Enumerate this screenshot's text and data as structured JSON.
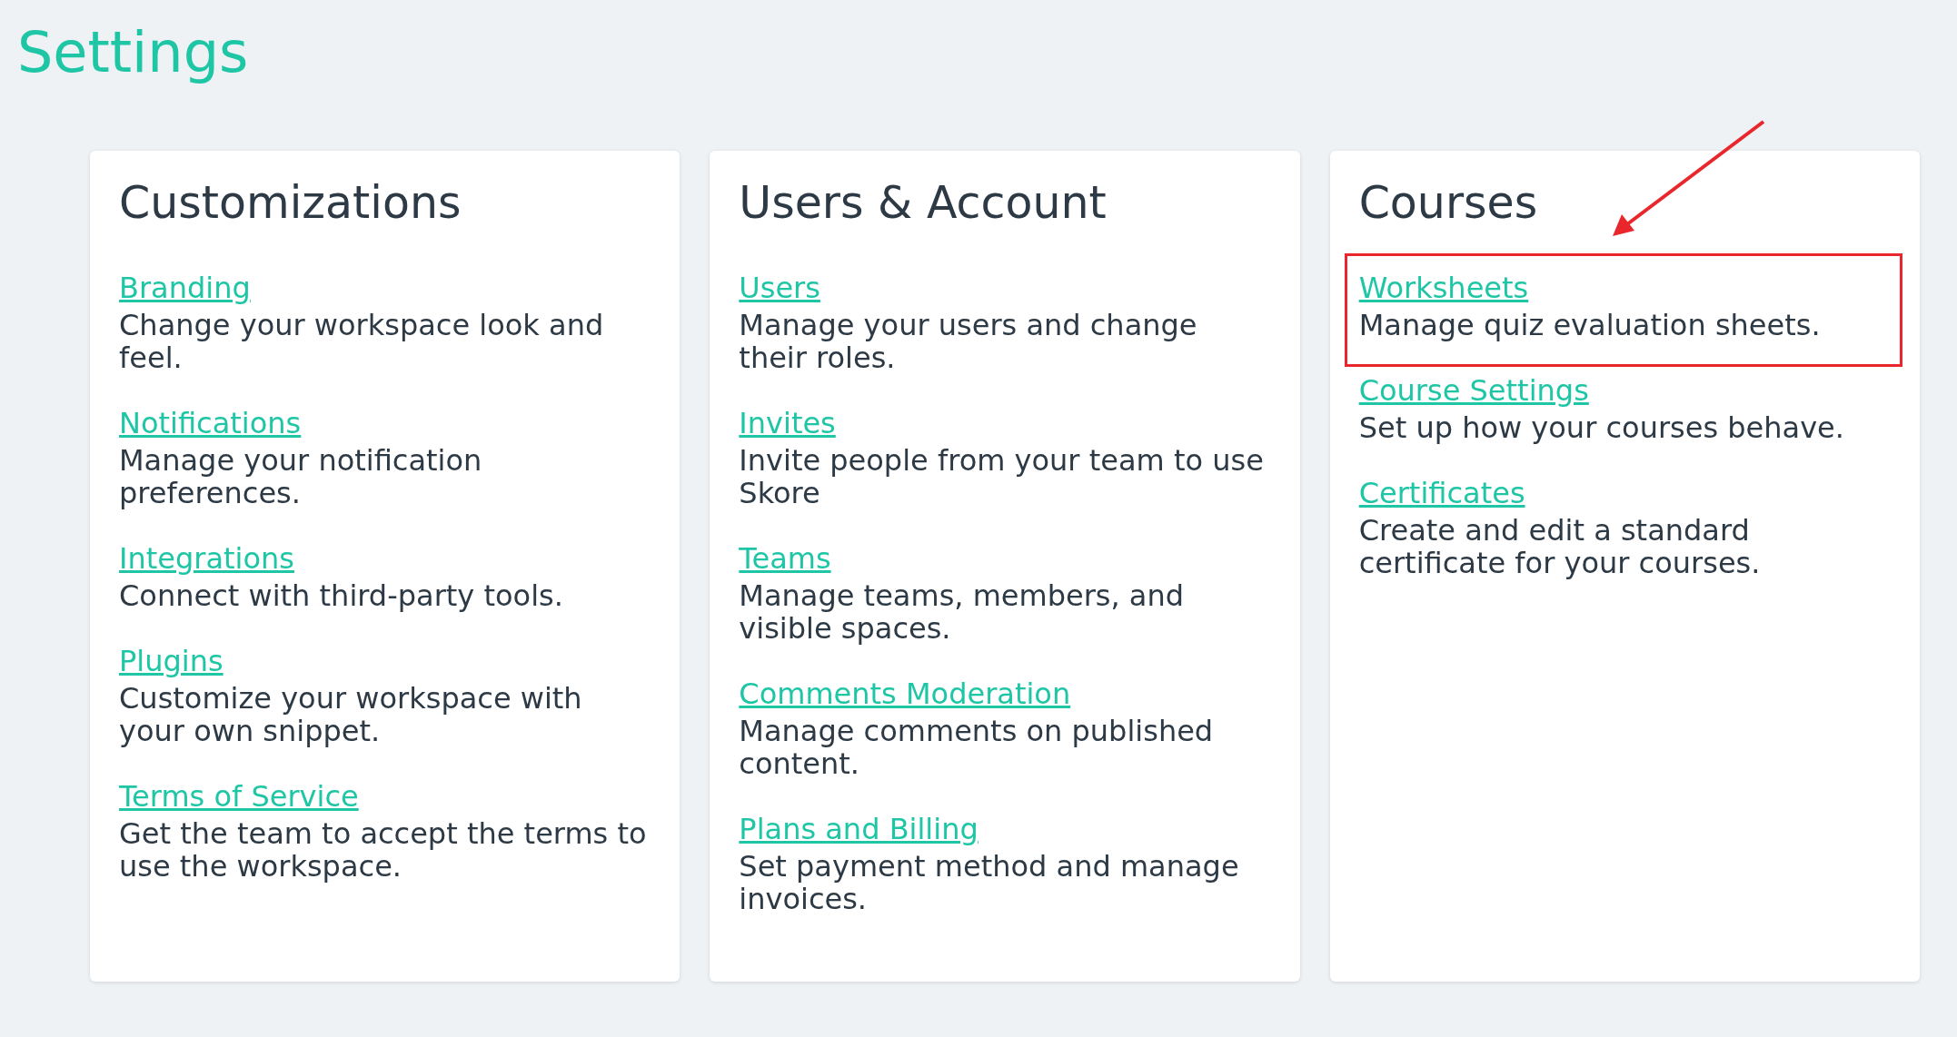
{
  "page_title": "Settings",
  "sections": [
    {
      "title": "Customizations",
      "items": [
        {
          "link": "Branding",
          "description": "Change your workspace look and feel.",
          "highlighted": false
        },
        {
          "link": "Notifications",
          "description": "Manage your notification preferences.",
          "highlighted": false
        },
        {
          "link": "Integrations",
          "description": "Connect with third-party tools.",
          "highlighted": false
        },
        {
          "link": "Plugins",
          "description": "Customize your workspace with your own snippet.",
          "highlighted": false
        },
        {
          "link": "Terms of Service",
          "description": "Get the team to accept the terms to use the workspace.",
          "highlighted": false
        }
      ]
    },
    {
      "title": "Users & Account",
      "items": [
        {
          "link": "Users",
          "description": "Manage your users and change their roles.",
          "highlighted": false
        },
        {
          "link": "Invites",
          "description": "Invite people from your team to use Skore",
          "highlighted": false
        },
        {
          "link": "Teams",
          "description": "Manage teams, members, and visible spaces.",
          "highlighted": false
        },
        {
          "link": "Comments Moderation",
          "description": "Manage comments on published content.",
          "highlighted": false
        },
        {
          "link": "Plans and Billing",
          "description": "Set payment method and manage invoices.",
          "highlighted": false
        }
      ]
    },
    {
      "title": "Courses",
      "items": [
        {
          "link": "Worksheets",
          "description": "Manage quiz evaluation sheets.",
          "highlighted": true
        },
        {
          "link": "Course Settings",
          "description": "Set up how your courses behave.",
          "highlighted": false
        },
        {
          "link": "Certificates",
          "description": "Create and edit a standard certificate for your courses.",
          "highlighted": false
        }
      ]
    }
  ]
}
